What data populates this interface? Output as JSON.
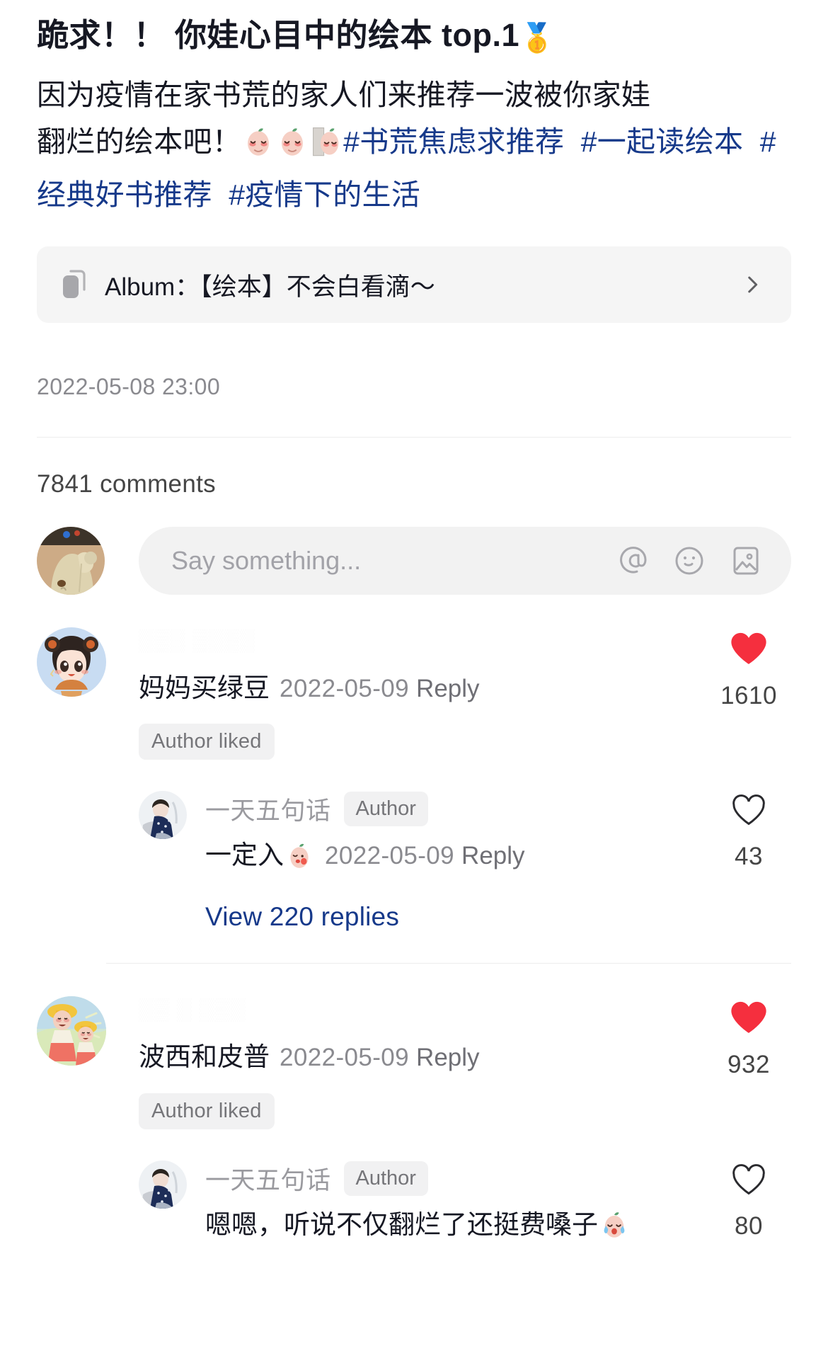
{
  "post": {
    "title": "跪求！！ 你娃心目中的绘本 top.1",
    "title_emoji": "🥇",
    "body_line1": "因为疫情在家书荒的家人们来推荐一波被你家娃",
    "body_line2_text": "翻烂的绘本吧！",
    "body_emojis": [
      "peach-pleading",
      "peach-pleading",
      "peach-peeking"
    ],
    "hashtags": [
      "#书荒焦虑求推荐",
      "#一起读绘本",
      "#经典好书推荐",
      "#疫情下的生活"
    ],
    "date": "2022-05-08 23:00"
  },
  "album": {
    "icon": "album-stack-icon",
    "label": "Album：【绘本】不会白看滴～",
    "chevron": "chevron-right-icon"
  },
  "comments_header": "7841 comments",
  "composer": {
    "placeholder": "Say something...",
    "icons": [
      "at-icon",
      "emoji-icon",
      "image-icon"
    ]
  },
  "comments": [
    {
      "masked_name": "▒▒▒ ▒▒▒▒",
      "text": "妈妈买绿豆",
      "date": "2022-05-09",
      "reply_label": "Reply",
      "badge": "Author liked",
      "likes": "1610",
      "liked": true,
      "avatar": "anime-girl-avatar",
      "reply": {
        "name": "一天五句话",
        "author_tag": "Author",
        "text": "一定入",
        "emoji": "peach-kiss",
        "date": "2022-05-09",
        "reply_label": "Reply",
        "likes": "43",
        "liked": false,
        "avatar": "child-navy-avatar"
      },
      "view_more": "View 220 replies"
    },
    {
      "masked_name": "▒▒ ▒ ▒▒▒",
      "text": "波西和皮普",
      "date": "2022-05-09",
      "reply_label": "Reply",
      "badge": "Author liked",
      "likes": "932",
      "liked": true,
      "avatar": "yellow-hat-avatar",
      "reply": {
        "name": "一天五句话",
        "author_tag": "Author",
        "text": "嗯嗯，听说不仅翻烂了还挺费嗓子",
        "emoji": "peach-crying",
        "date": "",
        "reply_label": "",
        "likes": "80",
        "liked": false,
        "avatar": "child-navy-avatar"
      },
      "view_more": ""
    }
  ],
  "colors": {
    "accent_link": "#16398a",
    "heart_red": "#f52f3e",
    "muted": "#8a8a8f",
    "card_bg": "#f5f5f5"
  }
}
